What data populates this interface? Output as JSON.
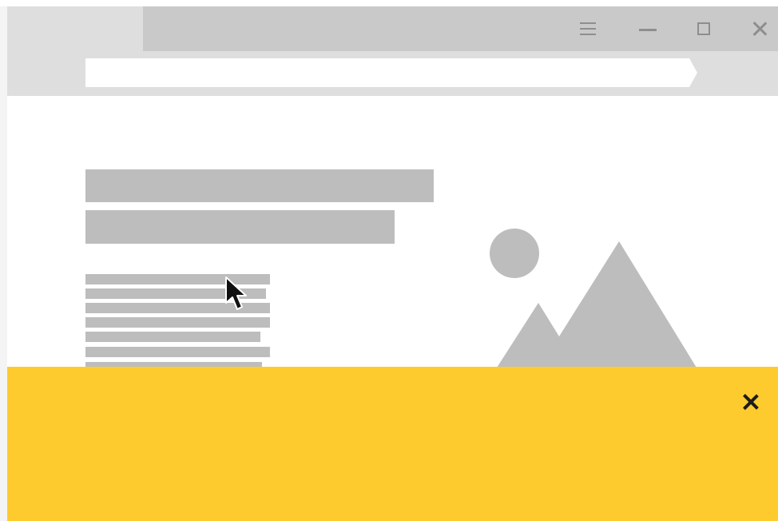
{
  "window": {
    "controls": [
      {
        "name": "menu",
        "icon": "hamburger-menu-icon"
      },
      {
        "name": "minimize",
        "icon": "minimize-icon"
      },
      {
        "name": "maximize",
        "icon": "maximize-icon"
      },
      {
        "name": "close",
        "icon": "close-icon"
      }
    ]
  },
  "address_bar": {
    "value": ""
  },
  "content": {
    "heading_placeholders": 2,
    "paragraph_placeholder_lines": 7,
    "image_placeholder_icon": "landscape-image-icon"
  },
  "banner": {
    "close_icon": "close-icon",
    "background_color": "#fecb2f"
  },
  "colors": {
    "chrome": "#dedede",
    "tab_bar": "#c9c9c9",
    "placeholder": "#bdbdbd",
    "banner": "#fecb2f"
  }
}
